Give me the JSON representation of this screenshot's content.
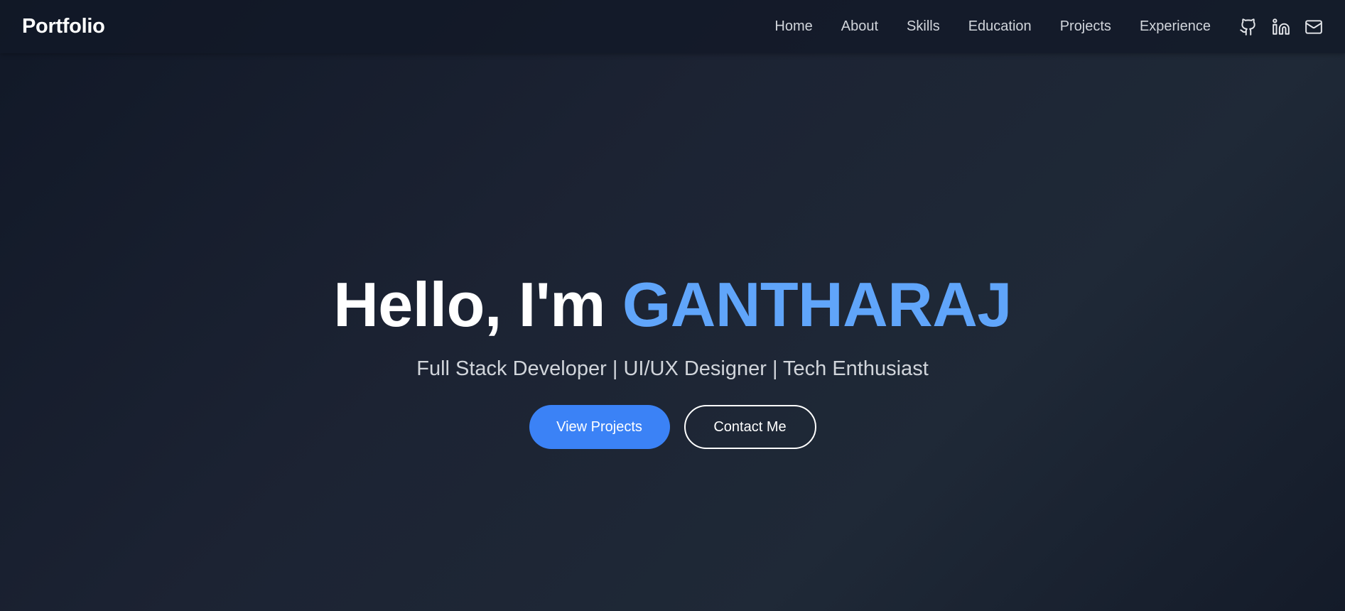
{
  "nav": {
    "brand": "Portfolio",
    "links": [
      "Home",
      "About",
      "Skills",
      "Education",
      "Projects",
      "Experience"
    ],
    "icons": [
      "github-icon",
      "linkedin-icon",
      "mail-icon"
    ]
  },
  "hero": {
    "greeting": "Hello, I'm",
    "name": "GANTHARAJ",
    "subtitle": "Full Stack Developer | UI/UX Designer | Tech Enthusiast",
    "primary_button": "View Projects",
    "secondary_button": "Contact Me"
  },
  "colors": {
    "accent": "#60a5fa",
    "button_primary": "#3b82f6",
    "background": "#111827",
    "nav_text": "#d1d5db"
  }
}
